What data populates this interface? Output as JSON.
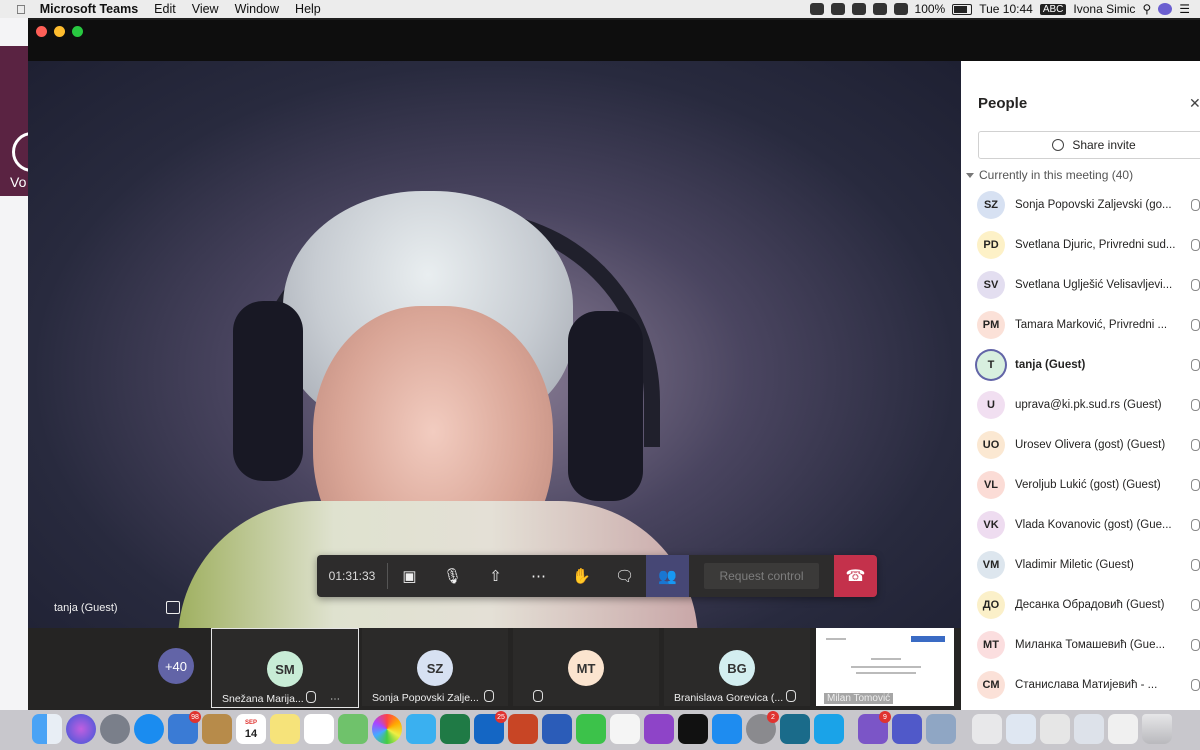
{
  "menubar": {
    "app_name": "Microsoft Teams",
    "menus": [
      "Edit",
      "View",
      "Window",
      "Help"
    ],
    "battery": "100%",
    "clock": "Tue 10:44",
    "input_source": "ABC",
    "user": "Ivona Simic"
  },
  "background_app": {
    "partial_text": "Vo"
  },
  "video": {
    "participant_label": "tanja (Guest)"
  },
  "controls": {
    "timer": "01:31:33",
    "request_control": "Request control",
    "icons": [
      "camera-off-icon",
      "mic-off-icon",
      "share-screen-icon",
      "more-icon",
      "raise-hand-icon",
      "chat-icon",
      "people-icon",
      "hang-up-icon"
    ]
  },
  "thumbnails": {
    "more_count": "+40",
    "tiles": [
      {
        "initials": "SM",
        "name": "Snežana Marija...",
        "color": "#c8ecd6"
      },
      {
        "initials": "SZ",
        "name": "Sonja Popovski Zalje...",
        "color": "#d7e1f2"
      },
      {
        "initials": "MT",
        "name": "",
        "color": "#fbe4cf"
      },
      {
        "initials": "BG",
        "name": "Branislava Gorevica (...",
        "color": "#d3eef0"
      }
    ],
    "shared_label": "Milan Tomović"
  },
  "people_panel": {
    "title": "People",
    "share_invite": "Share invite",
    "section_label": "Currently in this meeting (40)",
    "participants": [
      {
        "initials": "SZ",
        "name": "Sonja Popovski Zaljevski (go...",
        "color": "#d7e1f2",
        "bold": false
      },
      {
        "initials": "PD",
        "name": "Svetlana Djuric, Privredni sud...",
        "color": "#fdf1c7",
        "bold": false
      },
      {
        "initials": "SV",
        "name": "Svetlana Uglješić Velisavljevi...",
        "color": "#e3def0",
        "bold": false
      },
      {
        "initials": "PM",
        "name": "Tamara Marković, Privredni ...",
        "color": "#fbe1d8",
        "bold": false
      },
      {
        "initials": "T",
        "name": "tanja (Guest)",
        "color": "#d8efdf",
        "bold": true
      },
      {
        "initials": "U",
        "name": "uprava@ki.pk.sud.rs (Guest)",
        "color": "#f1dff1",
        "bold": false
      },
      {
        "initials": "UO",
        "name": "Urosev Olivera (gost) (Guest)",
        "color": "#fbe8d2",
        "bold": false
      },
      {
        "initials": "VL",
        "name": "Veroljub Lukić (gost) (Guest)",
        "color": "#fbdcd6",
        "bold": false
      },
      {
        "initials": "VK",
        "name": "Vlada Kovanovic (gost) (Gue...",
        "color": "#eedcf0",
        "bold": false
      },
      {
        "initials": "VM",
        "name": "Vladimir Miletic (Guest)",
        "color": "#dde6ee",
        "bold": false
      },
      {
        "initials": "ДО",
        "name": "Десанка Обрадовић (Guest)",
        "color": "#fbf0c9",
        "bold": false
      },
      {
        "initials": "МТ",
        "name": "Миланка Томашевић (Gue...",
        "color": "#fbdedf",
        "bold": false
      },
      {
        "initials": "СМ",
        "name": "Станислава Матијевић - ...",
        "color": "#fbe1d8",
        "bold": false
      }
    ]
  },
  "dock": {
    "calendar_month": "SEP",
    "calendar_day": "14",
    "badges": {
      "mail": "98",
      "outlook": "25",
      "settings": "2",
      "viber": "9"
    }
  }
}
